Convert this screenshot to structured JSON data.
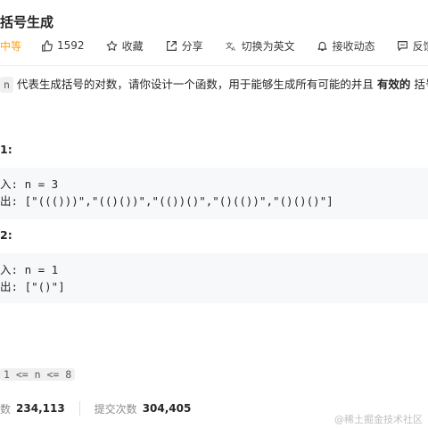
{
  "header": {
    "title": "括号生成"
  },
  "toolbar": {
    "difficulty": "中等",
    "likes": "1592",
    "favorite_label": "收藏",
    "share_label": "分享",
    "switch_lang_label": "切换为英文",
    "subscribe_label": "接收动态",
    "feedback_label": "反馈"
  },
  "description": {
    "code_n": "n",
    "text_before": "代表生成括号的对数，请你设计一个函数，用于能够生成所有可能的并且",
    "text_strong": "有效的",
    "text_after": "括号组"
  },
  "examples": [
    {
      "title": "1:",
      "input_label": "入:",
      "input_value": "n = 3",
      "output_label": "出:",
      "output_value": "[\"((()))\",\"(()())\",\"(())()\",\"()(())\",\"()()()\"]"
    },
    {
      "title": "2:",
      "input_label": "入:",
      "input_value": "n = 1",
      "output_label": "出:",
      "output_value": "[\"()\"]"
    }
  ],
  "constraint": "1 <= n <= 8",
  "stats": {
    "accepted_label": "数",
    "accepted_value": "234,113",
    "submissions_label": "提交次数",
    "submissions_value": "304,405"
  },
  "watermark": "@稀土掘金技术社区"
}
